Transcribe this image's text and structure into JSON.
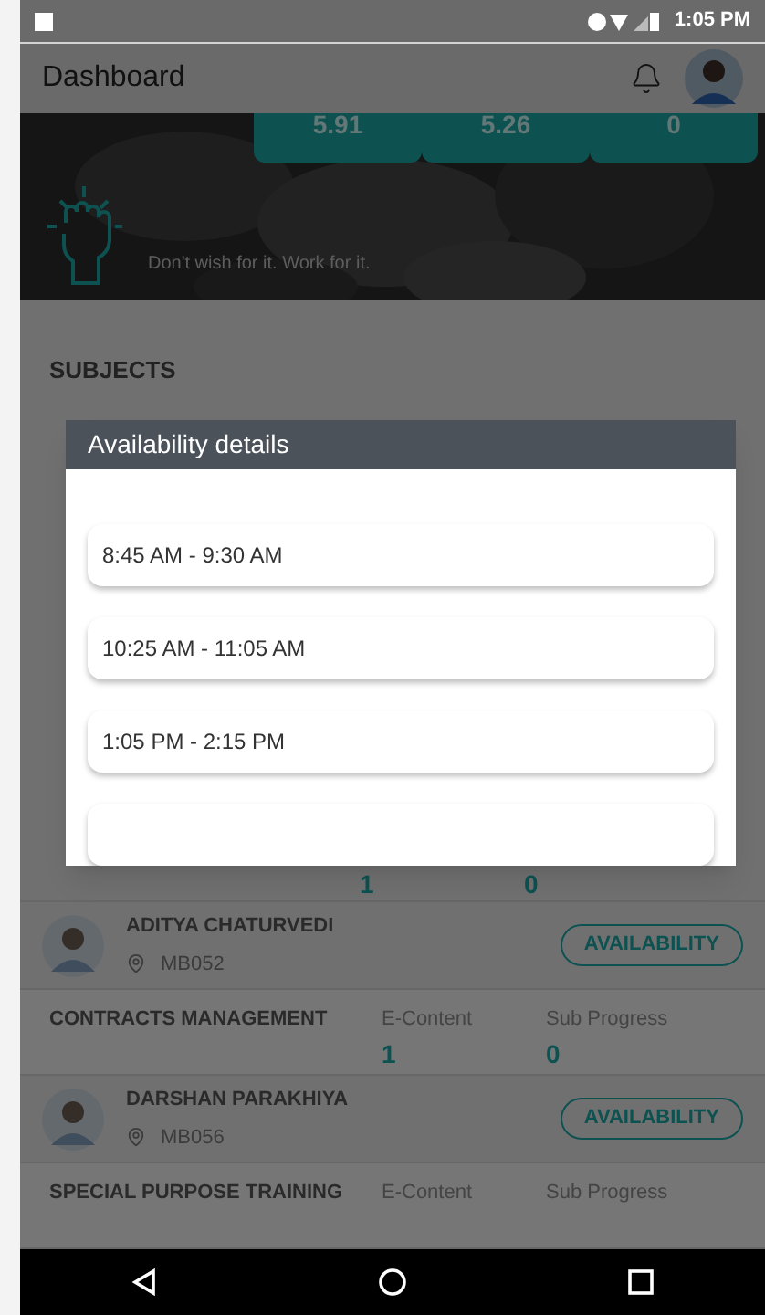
{
  "status_bar": {
    "time": "1:05 PM"
  },
  "header": {
    "title": "Dashboard"
  },
  "stats": [
    {
      "value": "5.91"
    },
    {
      "value": "5.26"
    },
    {
      "value": "0"
    }
  ],
  "banner": {
    "quote": "Don't wish for it. Work for it."
  },
  "section_title": "SUBJECTS",
  "list": [
    {
      "kind": "values",
      "e_content": "1",
      "sub_progress": "0"
    },
    {
      "kind": "teacher",
      "name": "ADITYA CHATURVEDI",
      "room": "MB052",
      "button": "AVAILABILITY"
    },
    {
      "kind": "subject",
      "name": "CONTRACTS MANAGEMENT",
      "e_content_label": "E-Content",
      "sub_progress_label": "Sub Progress",
      "e_content": "1",
      "sub_progress": "0"
    },
    {
      "kind": "teacher",
      "name": "DARSHAN PARAKHIYA",
      "room": "MB056",
      "button": "AVAILABILITY"
    },
    {
      "kind": "subject",
      "name": "SPECIAL PURPOSE TRAINING",
      "e_content_label": "E-Content",
      "sub_progress_label": "Sub Progress"
    }
  ],
  "dialog": {
    "title": "Availability details",
    "slots": [
      "8:45 AM - 9:30 AM",
      "10:25 AM - 11:05 AM",
      "1:05 PM - 2:15 PM"
    ]
  }
}
